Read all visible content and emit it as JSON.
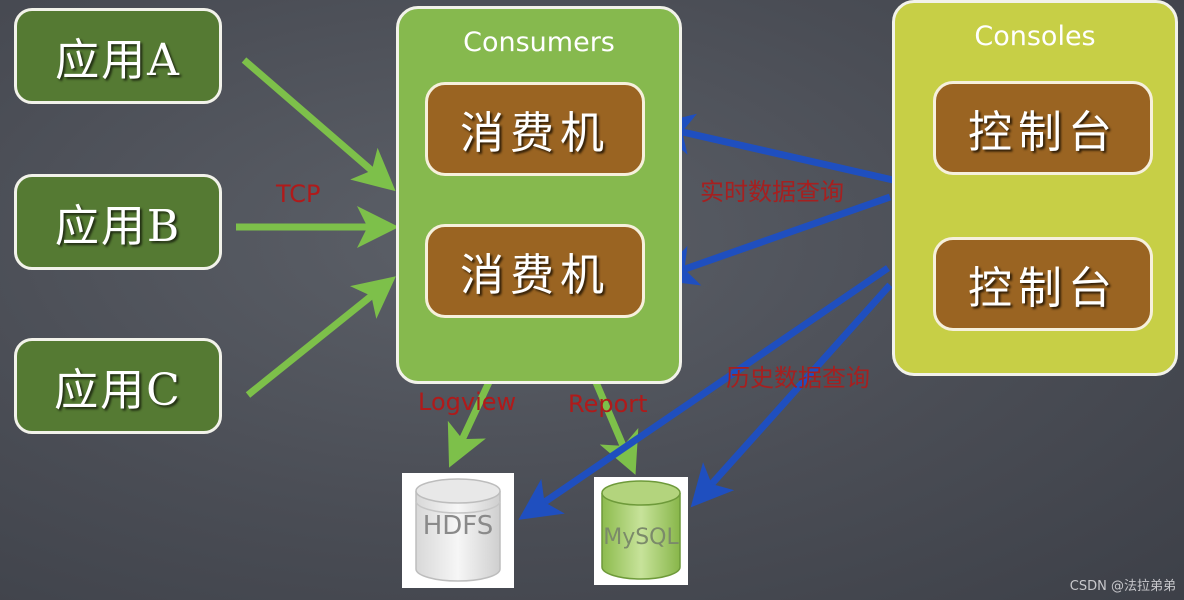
{
  "apps": [
    {
      "label": "应用A"
    },
    {
      "label": "应用B"
    },
    {
      "label": "应用C"
    }
  ],
  "consumers": {
    "title": "Consumers",
    "nodes": [
      {
        "label": "消费机"
      },
      {
        "label": "消费机"
      }
    ]
  },
  "consoles": {
    "title": "Consoles",
    "nodes": [
      {
        "label": "控制台"
      },
      {
        "label": "控制台"
      }
    ]
  },
  "edge_labels": {
    "tcp": "TCP",
    "realtime_query": "实时数据查询",
    "history_query": "历史数据查询",
    "logview": "Logview",
    "report": "Report"
  },
  "storage": {
    "hdfs": "HDFS",
    "mysql": "MySQL"
  },
  "colors": {
    "app_fill": "#557a33",
    "consumers_fill": "#86b94e",
    "consoles_fill": "#c7cf46",
    "node_fill": "#9a6422",
    "green_arrow": "#7dc04a",
    "blue_arrow": "#1f4fbf",
    "label_red": "#b01a1a"
  },
  "watermark": "CSDN @法拉弟弟"
}
